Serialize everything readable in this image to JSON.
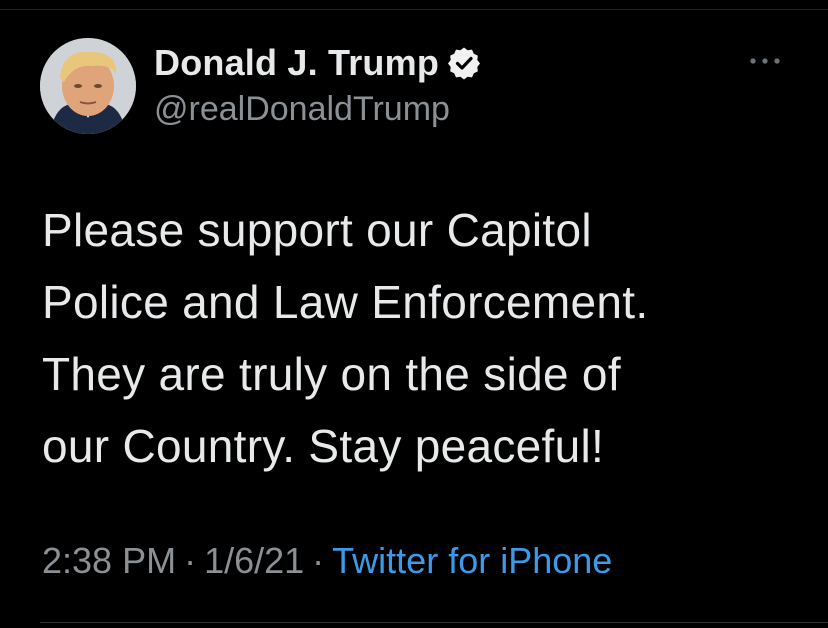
{
  "user": {
    "display_name": "Donald J. Trump",
    "handle": "@realDonaldTrump",
    "verified": true
  },
  "tweet": {
    "lines": [
      "Please support our Capitol",
      "Police and Law Enforcement.",
      "They are truly on the side of",
      "our Country. Stay peaceful!"
    ],
    "time": "2:38 PM",
    "date": "1/6/21",
    "separator": "·",
    "source": "Twitter for iPhone"
  },
  "icons": {
    "verified": "verified-badge-icon",
    "more": "more-options-icon"
  },
  "colors": {
    "background": "#000000",
    "text": "#e7e9ea",
    "secondary": "#8b9095",
    "link": "#3d9ae8"
  }
}
